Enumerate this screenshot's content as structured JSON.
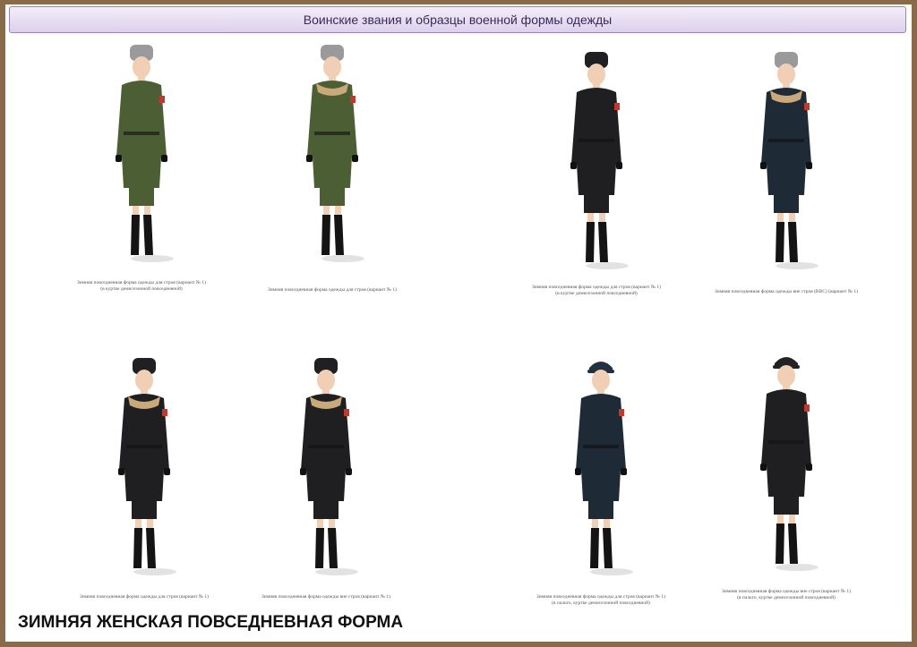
{
  "header": {
    "title": "Воинские звания и образцы военной формы одежды"
  },
  "figures": [
    {
      "coat": "green",
      "hat": "grey-fur",
      "fur_collar": false,
      "caption1": "Зимняя повседневная форма одежды для строя (вариант № 1)",
      "caption2": "(в куртке демисезонной повседневной)"
    },
    {
      "coat": "green",
      "hat": "grey-fur",
      "fur_collar": true,
      "caption1": "Зимняя повседневная форма одежды для строя (вариант № 1)",
      "caption2": ""
    },
    {
      "coat": "black",
      "hat": "black-fur",
      "fur_collar": false,
      "caption1": "Зимняя повседневная форма одежды для строя (вариант № 1)",
      "caption2": "(в куртке демисезонной повседневной)"
    },
    {
      "coat": "navy",
      "hat": "grey-fur",
      "fur_collar": true,
      "caption1": "Зимняя повседневная форма одежды вне строя (ВВС) (вариант № 1)",
      "caption2": ""
    },
    {
      "coat": "black",
      "hat": "black-fur",
      "fur_collar": true,
      "caption1": "Зимняя повседневная форма одежды для строя (вариант № 1)",
      "caption2": ""
    },
    {
      "coat": "black",
      "hat": "black-fur",
      "fur_collar": true,
      "caption1": "Зимняя повседневная форма одежды вне строя (вариант № 1)",
      "caption2": ""
    },
    {
      "coat": "navy",
      "hat": "navy-cap",
      "fur_collar": false,
      "caption1": "Зимняя повседневная форма одежды для строя (вариант № 1)",
      "caption2": "(в пальто, куртке демисезонной повседневной)"
    },
    {
      "coat": "black",
      "hat": "black-cap",
      "fur_collar": false,
      "caption1": "Зимняя повседневная форма одежды вне строя (вариант № 1)",
      "caption2": "(в пальто, куртке демисезонной повседневной)"
    }
  ],
  "colors": {
    "green": "#4c5e34",
    "black": "#1f1f22",
    "navy": "#1e2a36",
    "grey-fur": "#9a9a9c",
    "black-fur": "#202022",
    "navy-cap": "#233040",
    "black-cap": "#222226",
    "skin": "#f0cfb4",
    "boot": "#141414",
    "fur": "#c9a97a"
  },
  "footer": {
    "title": "ЗИМНЯЯ ЖЕНСКАЯ ПОВСЕДНЕВНАЯ ФОРМА"
  }
}
